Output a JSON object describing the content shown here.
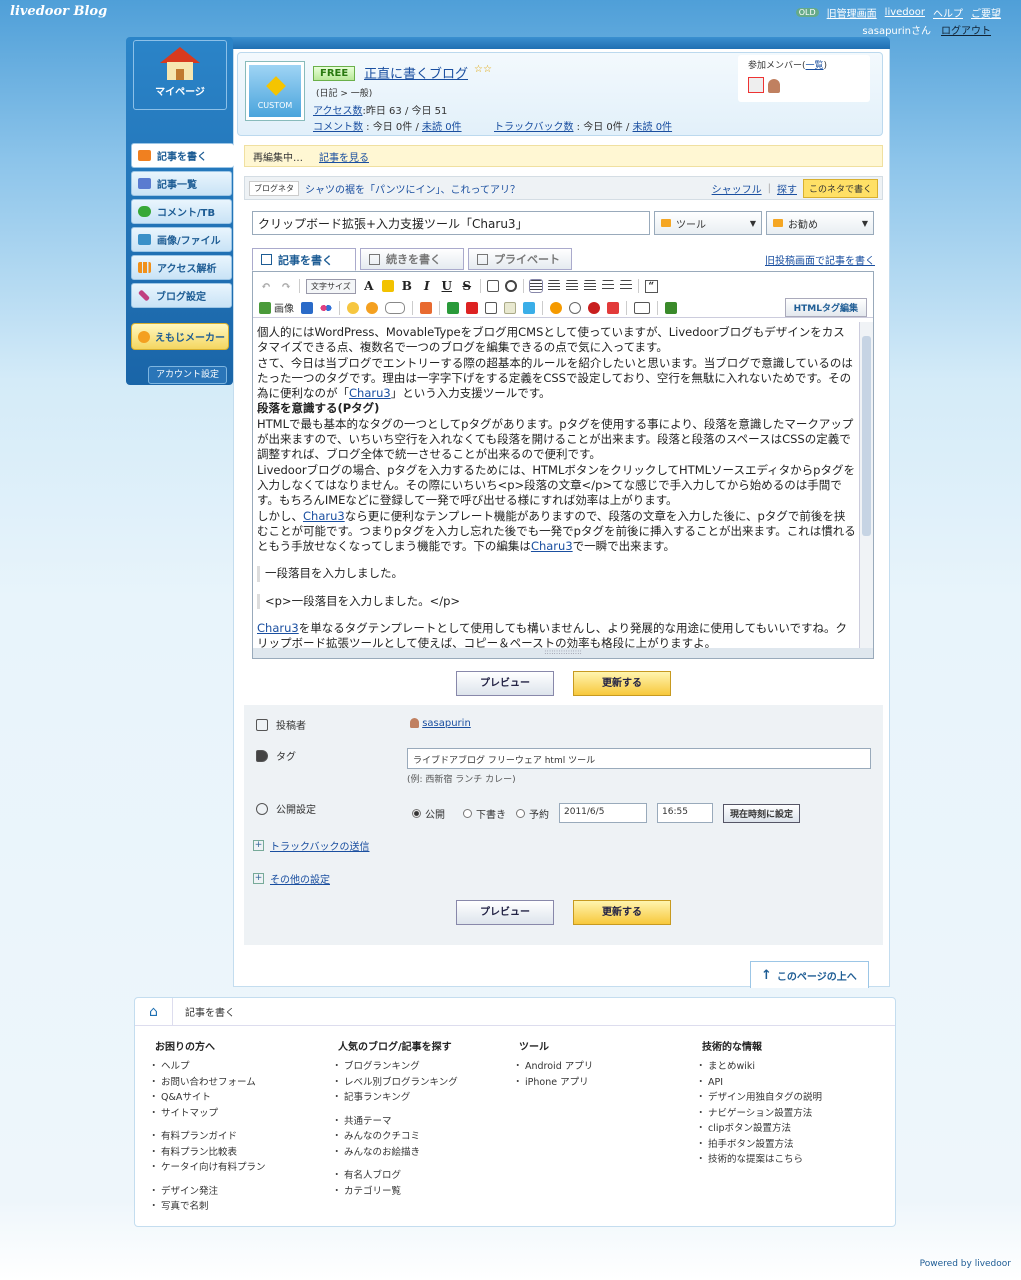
{
  "header": {
    "logo": "livedoor Blog",
    "old_badge": "OLD",
    "old_admin": "旧管理画面",
    "links": [
      "livedoor",
      "ヘルプ",
      "ご要望"
    ],
    "user": "sasapurinさん",
    "logout": "ログアウト"
  },
  "sidebar": {
    "mypage": "マイページ",
    "items": [
      {
        "label": "記事を書く",
        "icon": "pencil-icon",
        "color": "#f08020"
      },
      {
        "label": "記事一覧",
        "icon": "list-icon",
        "color": "#5a7bd0"
      },
      {
        "label": "コメント/TB",
        "icon": "speech-bubble-icon",
        "color": "#38a838"
      },
      {
        "label": "画像/ファイル",
        "icon": "image-icon",
        "color": "#3a90c8"
      },
      {
        "label": "アクセス解析",
        "icon": "bar-chart-icon",
        "color": "#f0901a"
      },
      {
        "label": "ブログ設定",
        "icon": "wrench-icon",
        "color": "#c04080"
      }
    ],
    "emoji_maker": "えもじメーカー",
    "account": "アカウント設定"
  },
  "bloginfo": {
    "custom": "CUSTOM",
    "plan": "FREE",
    "title": "正直に書くブログ",
    "stars": "☆☆",
    "category": "(日記 > 一般)",
    "access_label": "アクセス数",
    "access_value": ":昨日 63 / 今日 51",
    "comments_label": "コメント数",
    "comments_today": "今日 0件",
    "comments_unread": "未読 0件",
    "tb_label": "トラックバック数",
    "tb_today": "今日 0件",
    "tb_unread": "未読 0件",
    "members_label": "参加メンバー",
    "members_link": "一覧"
  },
  "notice": {
    "text": "再編集中…",
    "link": "記事を見る"
  },
  "neta": {
    "label": "ブログネタ",
    "text": "シャツの裾を「パンツにイン」、これってアリ？",
    "shuffle": "シャッフル",
    "search": "探す",
    "write": "このネタで書く"
  },
  "editor": {
    "title": "クリップボード拡張+入力支援ツール「Charu3」",
    "category1": "ツール",
    "category2": "お勧め",
    "tabs": [
      "記事を書く",
      "続きを書く",
      "プライベート"
    ],
    "old_post": "旧投稿画面で記事を書く",
    "font_size": "文字サイズ",
    "image_label": "画像",
    "html_edit": "HTMLタグ編集",
    "body": [
      "個人的にはWordPress、MovableTypeをブログ用CMSとして使っていますが、Livedoorブログもデザインをカスタマイズできる点、複数名で一つのブログを編集できるの点で気に入ってます。",
      "さて、今日は当ブログでエントリーする際の超基本的ルールを紹介したいと思います。当ブログで意識しているのはたった一つのタグです。理由は一字字下げをする定義をCSSで設定しており、空行を無駄に入れないためです。その為に便利なのが「",
      "Charu3",
      "」という入力支援ツールです。",
      "段落を意識する(Pタグ)",
      "HTMLで最も基本的なタグの一つとしてpタグがあります。pタグを使用する事により、段落を意識したマークアップが出来ますので、いちいち空行を入れなくても段落を開けることが出来ます。段落と段落のスペースはCSSの定義で調整すれば、ブログ全体で統一させることが出来るので便利です。",
      "Livedoorブログの場合、pタグを入力するためには、HTMLボタンをクリックしてHTMLソースエディタからpタグを入力しなくてはなりません。その際にいちいち<p>段落の文章</p>てな感じで手入力してから始めるのは手間です。もちろんIMEなどに登録して一発で呼び出せる様にすれば効率は上がります。",
      "しかし、",
      "Charu3",
      "なら更に便利なテンプレート機能がありますので、段落の文章を入力した後に、pタグで前後を挟むことが可能です。つまりpタグを入力し忘れた後でも一発でpタグを前後に挿入することが出来ます。これは慣れるともう手放せなくなってしまう機能です。下の編集は",
      "Charu3",
      "で一瞬で出来ます。",
      "一段落目を入力しました。",
      "<p>一段落目を入力しました。</p>",
      "Charu3",
      "を単なるタグテンプレートとして使用しても構いませんし、より発展的な用途に使用してもいいですね。クリップボード拡張ツールとして使えば、コピー＆ペーストの効率も格段に上がりますよ。"
    ],
    "preview": "プレビュー",
    "update": "更新する"
  },
  "meta": {
    "author_label": "投稿者",
    "author": "sasapurin",
    "tag_label": "タグ",
    "tags": "ライブドアブログ フリーウェア html ツール",
    "tag_example": "(例: 西新宿 ランチ カレー)",
    "publish_label": "公開設定",
    "opt_public": "公開",
    "opt_draft": "下書き",
    "opt_schedule": "予約",
    "date": "2011/6/5",
    "time": "16:55",
    "now_button": "現在時刻に設定",
    "trackback": "トラックバックの送信",
    "other": "その他の設定"
  },
  "pagetop": "このページの上へ",
  "footer": {
    "crumb": "記事を書く",
    "col1_title": "お困りの方へ",
    "col1": [
      "ヘルプ",
      "お問い合わせフォーム",
      "Q&Aサイト",
      "サイトマップ",
      "",
      "有料プランガイド",
      "有料プラン比較表",
      "ケータイ向け有料プラン",
      "",
      "デザイン発注",
      "写真で名刺"
    ],
    "col2_title": "人気のブログ/記事を探す",
    "col2": [
      "ブログランキング",
      "レベル別ブログランキング",
      "記事ランキング",
      "",
      "共通テーマ",
      "みんなのクチコミ",
      "みんなのお絵描き",
      "",
      "有名人ブログ",
      "カテゴリー覧"
    ],
    "col3_title": "ツール",
    "col3": [
      "Android アプリ",
      "iPhone アプリ"
    ],
    "col4_title": "技術的な情報",
    "col4": [
      "まとめwiki",
      "API",
      "デザイン用独自タグの説明",
      "ナビゲーション設置方法",
      "clipボタン設置方法",
      "拍手ボタン設置方法",
      "技術的な提案はこちら"
    ],
    "powered": "Powered by livedoor"
  }
}
